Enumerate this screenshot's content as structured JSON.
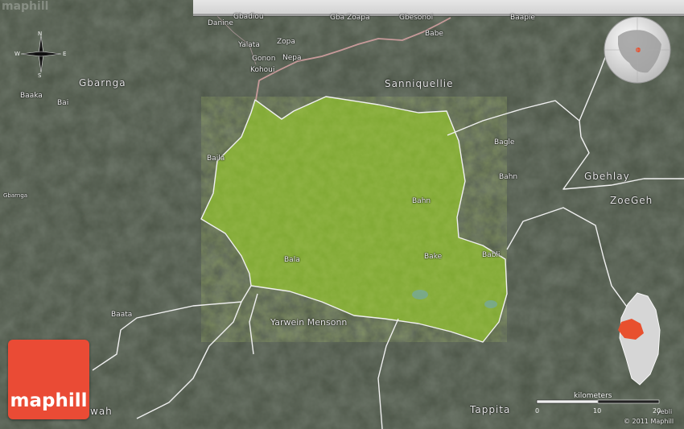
{
  "brand": {
    "label": "maphill"
  },
  "ghost_brand": "maphill",
  "compass": {
    "n": "N",
    "s": "S",
    "e": "E",
    "w": "W"
  },
  "scale": {
    "title": "kilometers",
    "ticks": [
      "0",
      "10",
      "20"
    ]
  },
  "copyright": "© 2011 Maphill",
  "colors": {
    "highlight": "#7fa832",
    "border": "#f0f0f0",
    "road": "#c79a9a",
    "brand": "#ea4b35",
    "inset_region": "#e8502e"
  },
  "labels": {
    "gbadiou": "Gbadiou",
    "danine": "Danine",
    "gba_zoapa": "Gba Zoapa",
    "gbesonoi": "Gbesonoi",
    "baapie": "Baapie",
    "babe": "Babe",
    "yalata": "Yalata",
    "zopa": "Zopa",
    "gonon": "Gonon",
    "nepa": "Nepa",
    "kohoui": "Kohoui",
    "gbarnga": "Gbarnga",
    "sanniquellie": "Sanniquellie",
    "baaka": "Baaka",
    "bai": "Bai",
    "baila": "Baila",
    "bagle": "Bagle",
    "bahn_east": "Bahn",
    "gbehlay": "Gbehlay",
    "zoegeh": "ZoeGeh",
    "bahn": "Bahn",
    "gbarnga_small": "Gbarnga",
    "bala": "Bala",
    "bake": "Bake",
    "babli": "Babli",
    "baata": "Baata",
    "yarwein_mensonn": "Yarwein Mensonn",
    "wah": "wah",
    "tappita": "Tappita",
    "yebli": "yebli"
  }
}
